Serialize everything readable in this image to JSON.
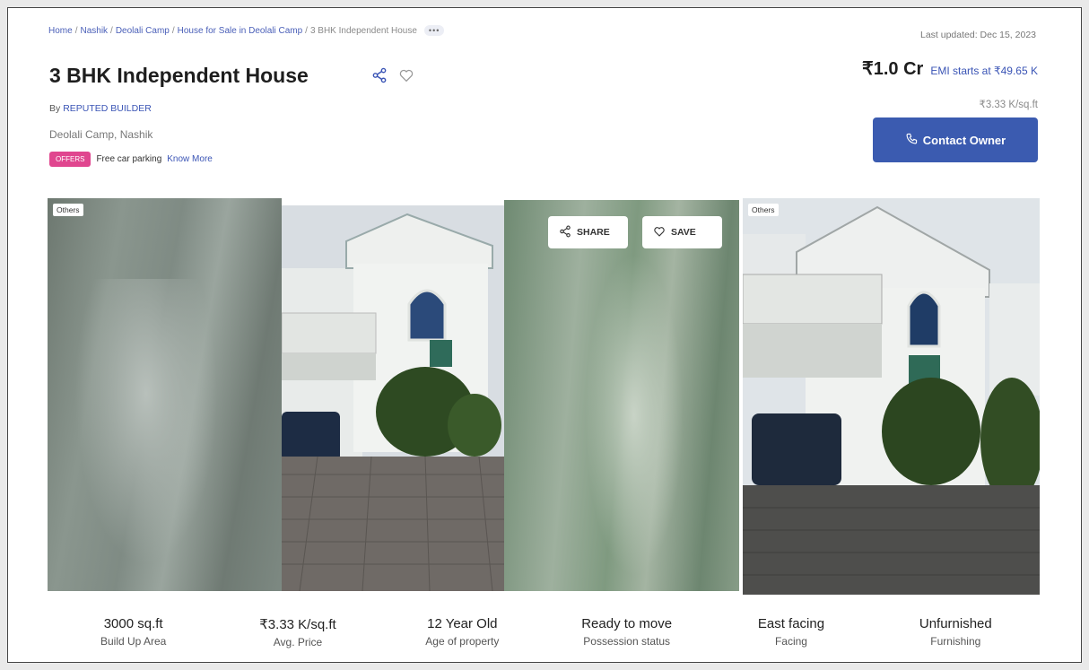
{
  "breadcrumb": {
    "items": [
      "Home",
      "Nashik",
      "Deolali Camp",
      "House for Sale in Deolali Camp",
      "3 BHK Independent House"
    ],
    "more_label": "•••"
  },
  "last_updated": "Last updated: Dec 15, 2023",
  "listing": {
    "title": "3 BHK Independent House",
    "by_prefix": "By",
    "builder": "REPUTED BUILDER",
    "locality": "Deolali Camp, Nashik",
    "offer_badge": "OFFERS",
    "offer_text": "Free car parking",
    "know_more": "Know More"
  },
  "pricing": {
    "price": "₹1.0 Cr",
    "emi": "EMI starts at ₹49.65 K",
    "per_sqft": "₹3.33 K/sq.ft"
  },
  "contact_button": {
    "label": "Contact Owner",
    "icon": "phone-icon"
  },
  "gallery": {
    "tag1": "Others",
    "tag4": "Others",
    "share_label": "SHARE",
    "save_label": "SAVE"
  },
  "stats": [
    {
      "value": "3000 sq.ft",
      "label": "Build Up Area"
    },
    {
      "value": "₹3.33 K/sq.ft",
      "label": "Avg. Price"
    },
    {
      "value": "12 Year Old",
      "label": "Age of property"
    },
    {
      "value": "Ready to move",
      "label": "Possession status"
    },
    {
      "value": "East facing",
      "label": "Facing"
    },
    {
      "value": "Unfurnished",
      "label": "Furnishing"
    }
  ],
  "colors": {
    "accent": "#3b5bb0",
    "offer_badge": "#e0468f",
    "link": "#3a54b5"
  }
}
